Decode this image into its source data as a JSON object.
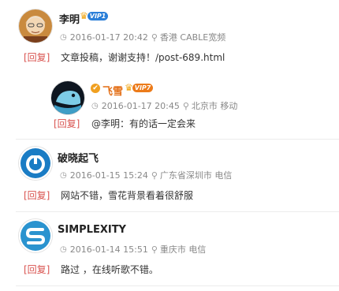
{
  "comments": [
    {
      "user": "李明",
      "vip": "VIP1",
      "time": "2016-01-17 20:42",
      "location": "香港 CABLE宽频",
      "reply_label": "[回复]",
      "content": "文章投稿，谢谢支持！/post-689.html",
      "reply": {
        "user": "飞雪",
        "vip": "VIP7",
        "time": "2016-01-17 20:45",
        "location": "北京市 移动",
        "reply_label": "[回复]",
        "content": "@李明：有的话一定会来"
      }
    },
    {
      "user": "破晓起飞",
      "time": "2016-01-15 15:24",
      "location": "广东省深圳市 电信",
      "reply_label": "[回复]",
      "content": "网站不错，雪花背景看着很舒服"
    },
    {
      "user": "SIMPLEXITY",
      "time": "2016-01-14 15:51",
      "location": "重庆市 电信",
      "reply_label": "[回复]",
      "content": "路过 ，在线听歌不错。"
    }
  ],
  "icons": {
    "clock": "clock-icon",
    "pin": "location-pin-icon",
    "crown": "crown-icon",
    "verified": "verified-icon"
  },
  "colors": {
    "reply": "#d9534f",
    "orange_name": "#e36e15",
    "vip_blue": "#2b7fd8",
    "vip_orange": "#ec7b1a"
  }
}
